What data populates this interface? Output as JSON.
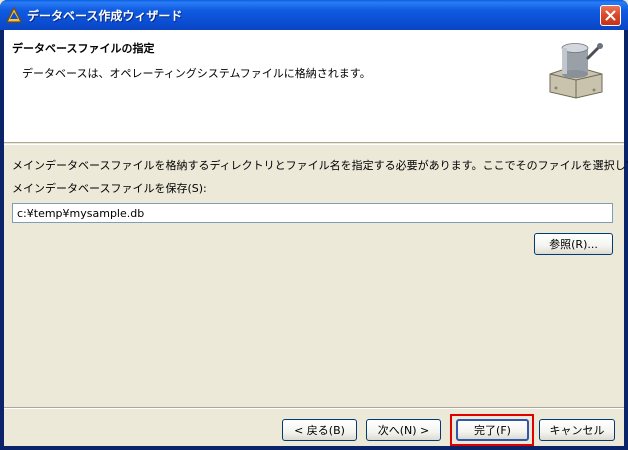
{
  "window": {
    "title": "データベース作成ウィザード"
  },
  "header": {
    "title": "データベースファイルの指定",
    "subtitle": "データベースは、オペレーティングシステムファイルに格納されます。"
  },
  "main": {
    "description": "メインデータベースファイルを格納するディレクトリとファイル名を指定する必要があります。ここでそのファイルを選択してください。",
    "save_label": "メインデータベースファイルを保存(S):",
    "path_value": "c:¥temp¥mysample.db",
    "browse_label": "参照(R)..."
  },
  "footer": {
    "back_label": "< 戻る(B)",
    "next_label": "次へ(N) >",
    "finish_label": "完了(F)",
    "cancel_label": "キャンセル"
  },
  "colors": {
    "titlebar": "#0b4fd4",
    "highlight": "#e00000"
  }
}
